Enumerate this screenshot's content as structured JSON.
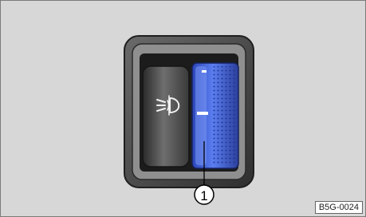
{
  "figure": {
    "callout_number": "1",
    "figure_code": "B5G-0024"
  },
  "icons": {
    "button_symbol": "fog-light-icon"
  },
  "colors": {
    "background": "#d7d7d7",
    "housing": "#4a4a4a",
    "wheel_blue": "#3f63d6",
    "callout_line": "#000000"
  }
}
